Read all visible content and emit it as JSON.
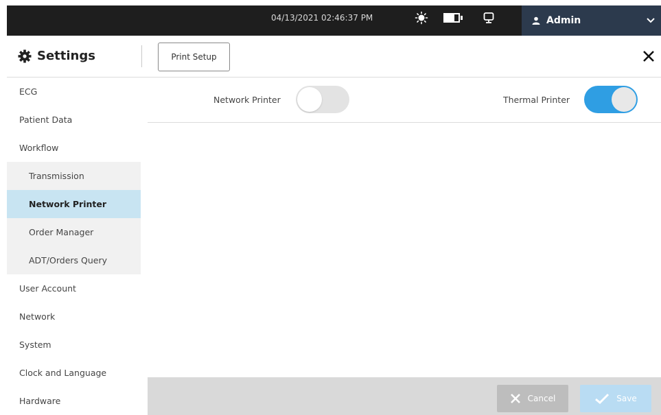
{
  "topbar": {
    "datetime": "04/13/2021 02:46:37 PM",
    "brightness_icon": "brightness-icon",
    "battery_icon": "battery-icon",
    "display_icon": "monitor-icon",
    "user_icon": "user-icon",
    "user": "Admin",
    "dropdown_icon": "chevron-down-icon"
  },
  "header": {
    "settings_icon": "gear-icon",
    "title": "Settings",
    "tab": "Print Setup",
    "close_icon": "close-icon"
  },
  "sidebar": {
    "items": [
      {
        "label": "ECG"
      },
      {
        "label": "Patient Data"
      },
      {
        "label": "Workflow"
      },
      {
        "label": "Transmission"
      },
      {
        "label": "Network Printer"
      },
      {
        "label": "Order Manager"
      },
      {
        "label": "ADT/Orders Query"
      },
      {
        "label": "User Account"
      },
      {
        "label": "Network"
      },
      {
        "label": "System"
      },
      {
        "label": "Clock and Language"
      },
      {
        "label": "Hardware"
      }
    ],
    "active": "Network Printer"
  },
  "content": {
    "network_printer": {
      "label": "Network Printer",
      "on": false
    },
    "thermal_printer": {
      "label": "Thermal Printer",
      "on": true
    }
  },
  "footer": {
    "cancel": "Cancel",
    "save": "Save"
  },
  "colors": {
    "topbar": "#1e1e1e",
    "admin_bg": "#2c3a4d",
    "active_nav": "#c8e4f2",
    "toggle_on": "#2f9ee3"
  }
}
